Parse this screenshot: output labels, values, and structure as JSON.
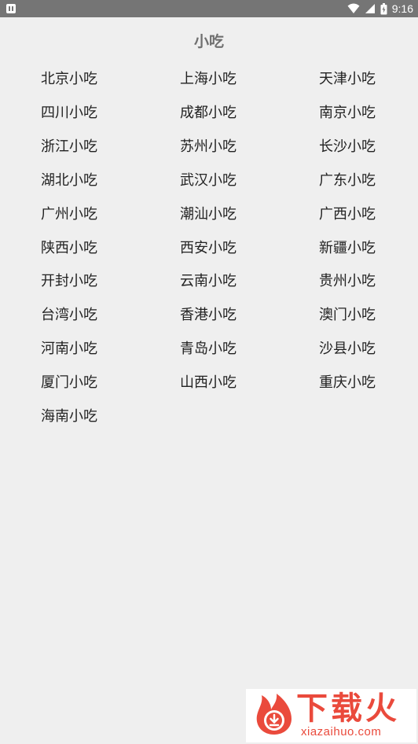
{
  "status_bar": {
    "time": "9:16",
    "icons": [
      "app-notification-icon",
      "wifi-icon",
      "signal-icon",
      "battery-icon"
    ]
  },
  "header": {
    "title": "小吃"
  },
  "items": [
    "北京小吃",
    "上海小吃",
    "天津小吃",
    "四川小吃",
    "成都小吃",
    "南京小吃",
    "浙江小吃",
    "苏州小吃",
    "长沙小吃",
    "湖北小吃",
    "武汉小吃",
    "广东小吃",
    "广州小吃",
    "潮汕小吃",
    "广西小吃",
    "陕西小吃",
    "西安小吃",
    "新疆小吃",
    "开封小吃",
    "云南小吃",
    "贵州小吃",
    "台湾小吃",
    "香港小吃",
    "澳门小吃",
    "河南小吃",
    "青岛小吃",
    "沙县小吃",
    "厦门小吃",
    "山西小吃",
    "重庆小吃",
    "海南小吃"
  ],
  "watermark": {
    "brand": "下载火",
    "url": "xiazaihuo.com",
    "color": "#ea4a3c"
  },
  "colors": {
    "background": "#efefef",
    "status_bar": "#757575",
    "title": "#6f6f6f",
    "item_text": "#222222"
  }
}
